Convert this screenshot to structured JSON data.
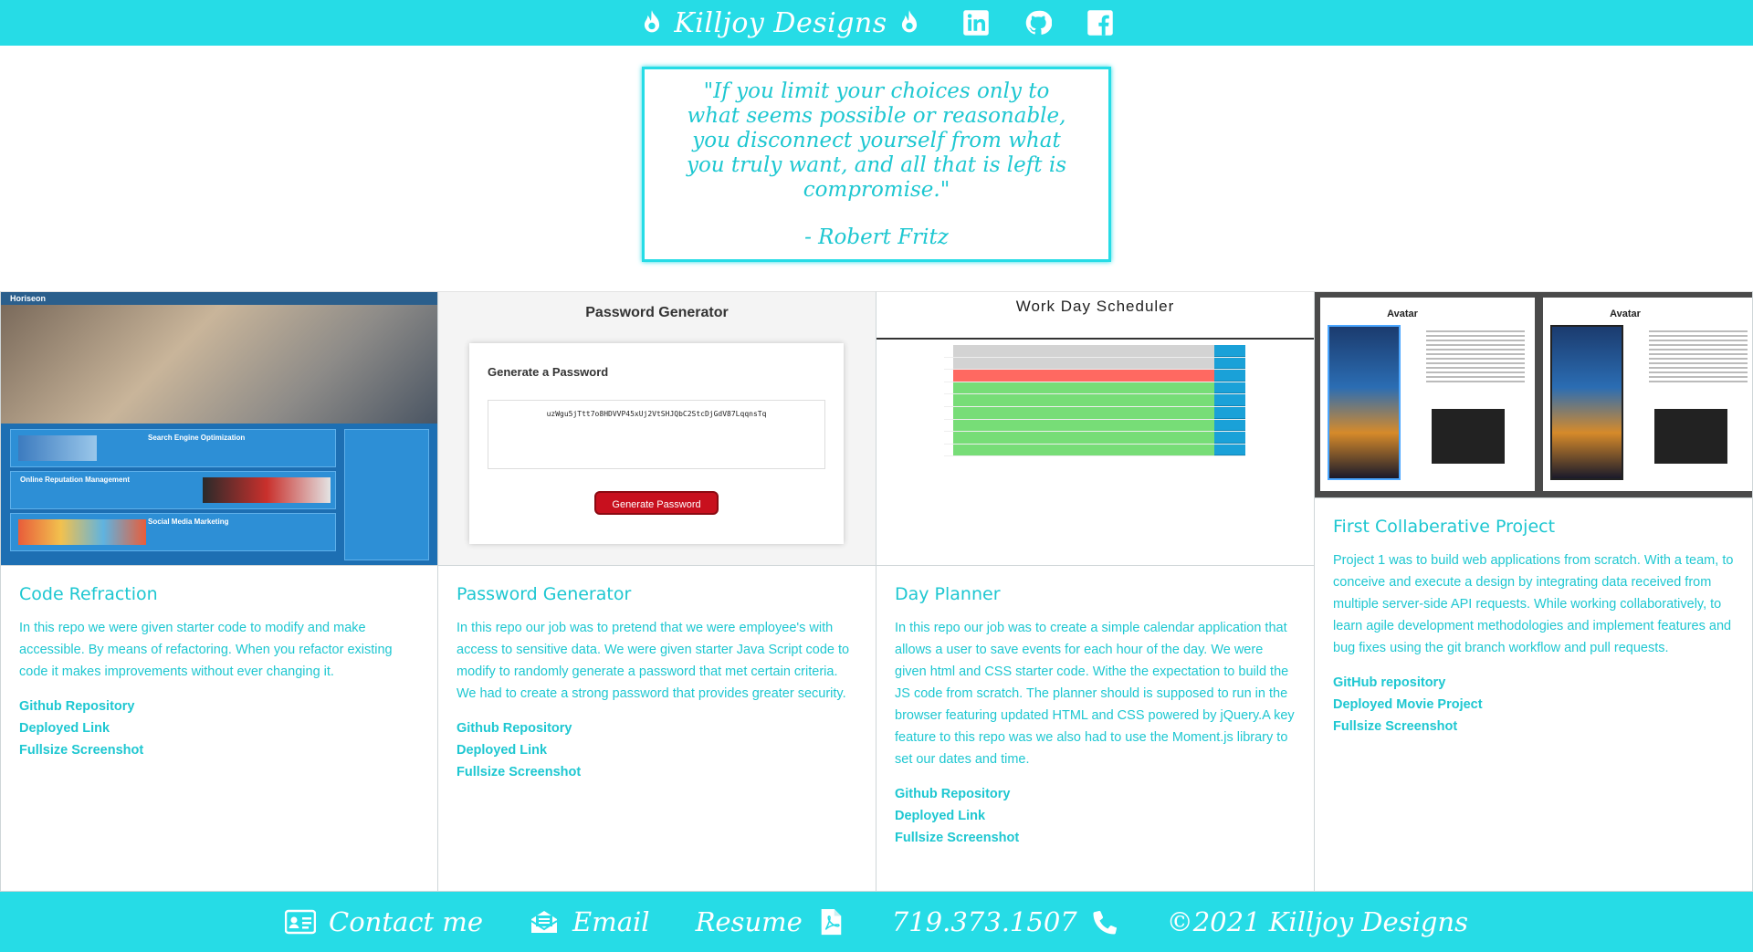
{
  "header": {
    "brand": "Killjoy Designs",
    "social_icons": [
      "linkedin-icon",
      "github-icon",
      "facebook-icon"
    ]
  },
  "quote": {
    "text": "\"If you limit your choices only to what seems possible or reasonable, you disconnect yourself from what you truly want, and all that is left is compromise.\"",
    "author": "- Robert Fritz"
  },
  "projects": [
    {
      "title": "Code Refraction",
      "description": "In this repo we were given starter code to modify and make accessible. By means of refactoring. When you refactor existing code it makes improvements without ever changing it.",
      "links": [
        "Github Repository",
        "Deployed Link",
        "Fullsize Screenshot"
      ],
      "screenshot": {
        "nav_brand": "Horiseon",
        "sections": [
          "Search Engine Optimization",
          "Online Reputation Management",
          "Social Media Marketing"
        ]
      }
    },
    {
      "title": "Password Generator",
      "description": "In this repo our job was to pretend that we were employee's with access to sensitive data. We were given starter Java Script code to modify to randomly generate a password that met certain criteria. We had to create a strong password that provides greater security.",
      "links": [
        "Github Repository",
        "Deployed Link",
        "Fullsize Screenshot"
      ],
      "screenshot": {
        "title": "Password Generator",
        "heading": "Generate a Password",
        "password": "uzWgu5jTtt7o8HDVVP45xUj2VtSHJQbC2StcDjGdV87LqqnsTq",
        "button": "Generate Password"
      }
    },
    {
      "title": "Day Planner",
      "description": "In this repo our job was to create a simple calendar application that allows a user to save events for each hour of the day. We were given html and CSS starter code. Withe the expectation to build the JS code from scratch. The planner should is supposed to run in the browser featuring updated HTML and CSS powered by jQuery.A key feature to this repo was we also had to use the Moment.js library to set our dates and time.",
      "links": [
        "Github Repository",
        "Deployed Link",
        "Fullsize Screenshot"
      ],
      "screenshot": {
        "title": "Work Day Scheduler",
        "row_states": [
          "past",
          "past",
          "present",
          "future",
          "future",
          "future",
          "future",
          "future",
          "future"
        ],
        "colors": {
          "past": "#d3d3d3",
          "present": "#ff6961",
          "future": "#77dd77",
          "save": "#1aa1d8"
        }
      }
    },
    {
      "title": "First Collaberative Project",
      "description": "Project 1 was to build web applications from scratch. With a team, to conceive and execute a design by integrating data received from multiple server-side API requests. While working collaboratively, to learn agile development methodologies and implement features and bug fixes using the git branch workflow and pull requests.",
      "links": [
        "GitHub repository",
        "Deployed Movie Project",
        "Fullsize Screenshot"
      ],
      "screenshot": {
        "page_title": "Avatar"
      }
    }
  ],
  "footer": {
    "contact": "Contact me",
    "email": "Email",
    "resume": "Resume",
    "phone": "719.373.1507",
    "copyright": "©2021 Killjoy Designs"
  },
  "colors": {
    "accent": "#26dce6",
    "text": "#1ec7d1"
  }
}
